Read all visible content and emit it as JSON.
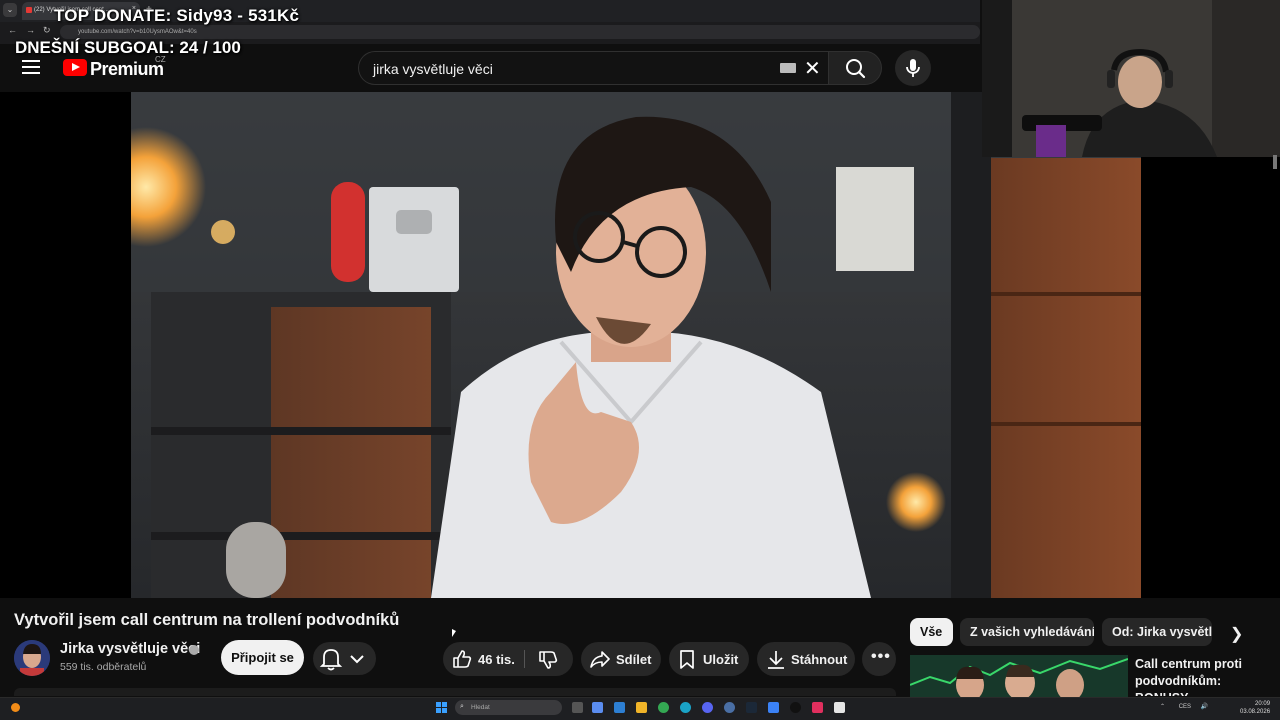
{
  "stream_overlay": {
    "top_donate": "TOP DONATE: Sidy93 - 531Kč",
    "subgoal": "DNEŠNÍ SUBGOAL: 24 / 100"
  },
  "browser": {
    "tab_title": "(22) Vytvořil jsem call cent...",
    "url": "youtube.com/watch?v=b10UysmAOw&t=40s"
  },
  "header": {
    "brand": "Premium",
    "region": "CZ",
    "search_value": "jirka vysvětluje věci"
  },
  "video": {
    "title": "Vytvořil jsem call centrum na trollení podvodníků",
    "channel_name": "Jirka vysvětluje věci",
    "subscribers": "559 tis. odběratelů",
    "subscribe_label": "Připojit se",
    "likes": "46 tis.",
    "share_label": "Sdílet",
    "save_label": "Uložit",
    "download_label": "Stáhnout"
  },
  "chips": [
    "Vše",
    "Z vašich vyhledávání",
    "Od: Jirka vysvětluje věci"
  ],
  "recommended": {
    "title": "Call centrum proti podvodníkům: BONUSY"
  },
  "taskbar": {
    "search_placeholder": "Hledat",
    "lang": "CES",
    "time": "20:09",
    "date": "03.08.2026"
  },
  "colors": {
    "yt_red": "#ff0000",
    "background": "#0f0f0f",
    "pill": "#272727"
  }
}
